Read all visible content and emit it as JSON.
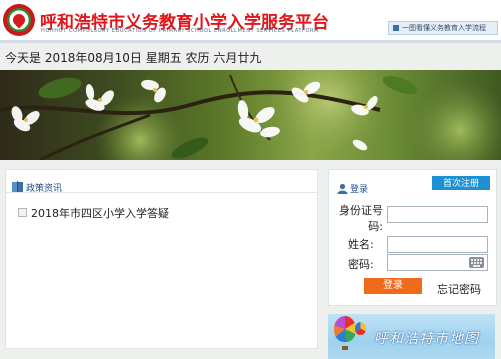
{
  "header": {
    "title": "呼和浩特市义务教育小学入学服务平台",
    "subtitle": "HOHHOT COMPULSORY EDUCATION OF PRIMARY SCHOOL ENROLLMENT SERVICES PLATFORM",
    "flow_link": "一图看懂义务教育入学流程"
  },
  "date_line": "今天是 2018年08月10日 星期五 农历 六月廿九",
  "policy": {
    "title": "政策资讯",
    "items": [
      "2018年市四区小学入学答疑"
    ]
  },
  "login": {
    "title": "登录",
    "first_register": "首次注册",
    "id_label_line1": "身份证号",
    "id_label_line2": "码:",
    "name_label": "姓名:",
    "password_label": "密码:",
    "login_button": "登录",
    "forgot": "忘记密码"
  },
  "city_banner": {
    "text": "呼和浩特市地图"
  },
  "colors": {
    "title_red": "#e0161b",
    "link_blue": "#1f4f87",
    "register_blue": "#1d8fd3",
    "login_orange": "#f06a1c"
  }
}
